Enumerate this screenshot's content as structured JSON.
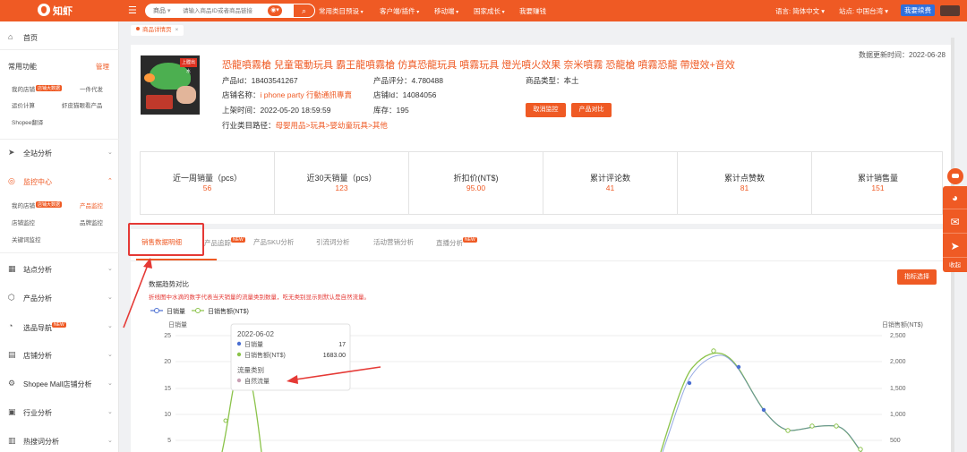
{
  "topbar": {
    "logo": "知虾",
    "search_select": "商品",
    "search_placeholder": "请输入商品ID或者商品链接",
    "nav": [
      "常用类目预设",
      "客户端/插件",
      "移动端",
      "国家成长",
      "我要赚钱"
    ],
    "lang": "语言: 简体中文 ▾",
    "site": "站点: 中国台湾 ▾",
    "renew": "我要续费"
  },
  "sidebar": {
    "home": "首页",
    "common": "常用功能",
    "manage": "管理",
    "common_items": [
      "我的店铺",
      "一件代发",
      "运价计算",
      "虾皮猫眼看产品",
      "Shopee翻译"
    ],
    "whole_site": "全站分析",
    "monitor": "监控中心",
    "monitor_items": [
      "我的店铺",
      "产品监控",
      "店铺监控",
      "品牌监控",
      "关键词监控"
    ],
    "sections": [
      "站点分析",
      "产品分析",
      "选品导航",
      "店铺分析",
      "Shopee Mall店铺分析",
      "行业分析",
      "热搜词分析"
    ],
    "tag_label": "店铺大数据",
    "new": "NEW"
  },
  "breadcrumb": {
    "label": "商品详情页"
  },
  "product": {
    "title": "恐龍噴霧槍 兒童電動玩具 霸王龍噴霧槍 仿真恐龍玩具 噴霧玩具 燈光噴火效果 奈米噴霧 恐龍槍 噴霧恐龍 帶燈效+音效",
    "updated_label": "数据更新时间：",
    "updated_value": "2022-06-28",
    "product_id_label": "产品Id：",
    "product_id": "18403541267",
    "rating_label": "产品评分：",
    "rating": "4.780488",
    "type_label": "商品类型：",
    "type": "本土",
    "shop_name_label": "店铺名称：",
    "shop_name": "i phone party 行動通訊專賣",
    "shop_id_label": "店铺Id：",
    "shop_id": "14084056",
    "listed_label": "上架时间：",
    "listed": "2022-05-20 18:59:59",
    "stock_label": "库存：",
    "stock": "195",
    "category_label": "行业类目路径：",
    "category": "母婴用品>玩具>婴幼童玩具>其他",
    "btn_cancel": "取消监控",
    "btn_compare": "产品对比",
    "image_badge": "上膛出水"
  },
  "stats": [
    {
      "label": "近一周销量（pcs）",
      "value": "56"
    },
    {
      "label": "近30天销量（pcs）",
      "value": "123"
    },
    {
      "label": "折扣价(NT$)",
      "value": "95.00"
    },
    {
      "label": "累计评论数",
      "value": "41"
    },
    {
      "label": "累计点赞数",
      "value": "81"
    },
    {
      "label": "累计销售量",
      "value": "151"
    }
  ],
  "tabs": [
    {
      "label": "销售数据明细",
      "new": false
    },
    {
      "label": "产品追踪",
      "new": true
    },
    {
      "label": "产品SKU分析",
      "new": false
    },
    {
      "label": "引流词分析",
      "new": false
    },
    {
      "label": "活动营销分析",
      "new": false
    },
    {
      "label": "直播分析",
      "new": true
    }
  ],
  "chart_section": {
    "title": "数据趋势对比",
    "note": "折线图中水滴的数字代表当天销量的流量类别数量，吃无类别显示则默认是自然流量。",
    "metric_btn": "指标选择"
  },
  "tooltip": {
    "date": "2022-06-02",
    "sales_label": "日销量",
    "sales": "17",
    "revenue_label": "日销售额(NT$)",
    "revenue": "1683.00",
    "traffic_title": "流量类别",
    "traffic_value": "自然流量"
  },
  "floatbar": {
    "collapse": "收起"
  },
  "chart_data": {
    "type": "line",
    "yleft_label": "日销量",
    "yright_label": "日销售额(NT$)",
    "yleft_ticks": [
      "25",
      "20",
      "15",
      "10",
      "5"
    ],
    "yright_ticks": [
      "2,500",
      "2,000",
      "1,500",
      "1,000",
      "500"
    ],
    "ylim_left": [
      0,
      25
    ],
    "ylim_right": [
      0,
      2500
    ],
    "series": [
      {
        "name": "日销量",
        "color": "#4b6fd1"
      },
      {
        "name": "日销售额(NT$)",
        "color": "#8bc34a"
      }
    ]
  },
  "colors": {
    "accent": "#ef5a24",
    "annot": "#e53935"
  }
}
